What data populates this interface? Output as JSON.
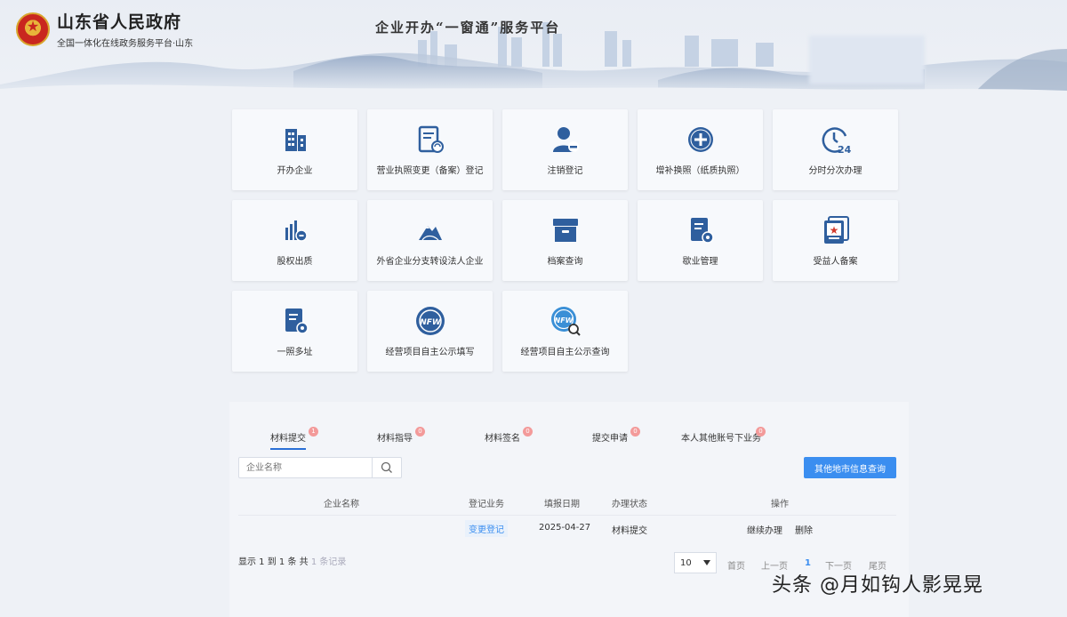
{
  "header": {
    "site_title": "山东省人民政府",
    "site_subtitle": "全国一体化在线政务服务平台·山东",
    "platform_title": "企业开办“一窗通”服务平台",
    "emblem_icon": "national-emblem-icon"
  },
  "tiles": [
    {
      "label": "开办企业",
      "icon": "building-icon"
    },
    {
      "label": "营业执照变更（备案）登记",
      "icon": "document-refresh-icon"
    },
    {
      "label": "注销登记",
      "icon": "user-minus-icon"
    },
    {
      "label": "增补换照（纸质执照）",
      "icon": "plus-circle-icon"
    },
    {
      "label": "分时分次办理",
      "icon": "clock-24-icon"
    },
    {
      "label": "股权出质",
      "icon": "bar-chart-icon"
    },
    {
      "label": "外省企业分支转设法人企业",
      "icon": "mountain-icon"
    },
    {
      "label": "档案查询",
      "icon": "archive-box-icon"
    },
    {
      "label": "歇业管理",
      "icon": "document-gear-icon"
    },
    {
      "label": "受益人备案",
      "icon": "star-card-icon"
    },
    {
      "label": "一照多址",
      "icon": "document-gear-icon"
    },
    {
      "label": "经营项目自主公示填写",
      "icon": "nfw-badge-icon"
    },
    {
      "label": "经营项目自主公示查询",
      "icon": "nfw-search-icon"
    }
  ],
  "tabs": [
    {
      "label": "材料提交",
      "badge": "1",
      "active": true
    },
    {
      "label": "材料指导",
      "badge": "0",
      "active": false
    },
    {
      "label": "材料签名",
      "badge": "0",
      "active": false
    },
    {
      "label": "提交申请",
      "badge": "0",
      "active": false
    },
    {
      "label": "本人其他账号下业务",
      "badge": "0",
      "active": false
    }
  ],
  "search": {
    "placeholder": "企业名称"
  },
  "query_button": "其他地市信息查询",
  "table": {
    "headers": [
      "企业名称",
      "登记业务",
      "填报日期",
      "办理状态",
      "操作"
    ],
    "row": {
      "company": "",
      "business": "变更登记",
      "date": "2025-04-27",
      "status": "材料提交",
      "action_continue": "继续办理",
      "action_delete": "删除"
    }
  },
  "summary": {
    "prefix": "显示 1 到 1 条 共",
    "faint": "1 条记录"
  },
  "pager": {
    "page_size": "10",
    "first": "首页",
    "prev": "上一页",
    "current": "1",
    "next": "下一页",
    "last": "尾页"
  },
  "watermark": "头条 @月如钩人影晃晃",
  "colors": {
    "primary": "#3b8ef0",
    "icon": "#2f5f9e",
    "badge": "#f39a9a"
  }
}
